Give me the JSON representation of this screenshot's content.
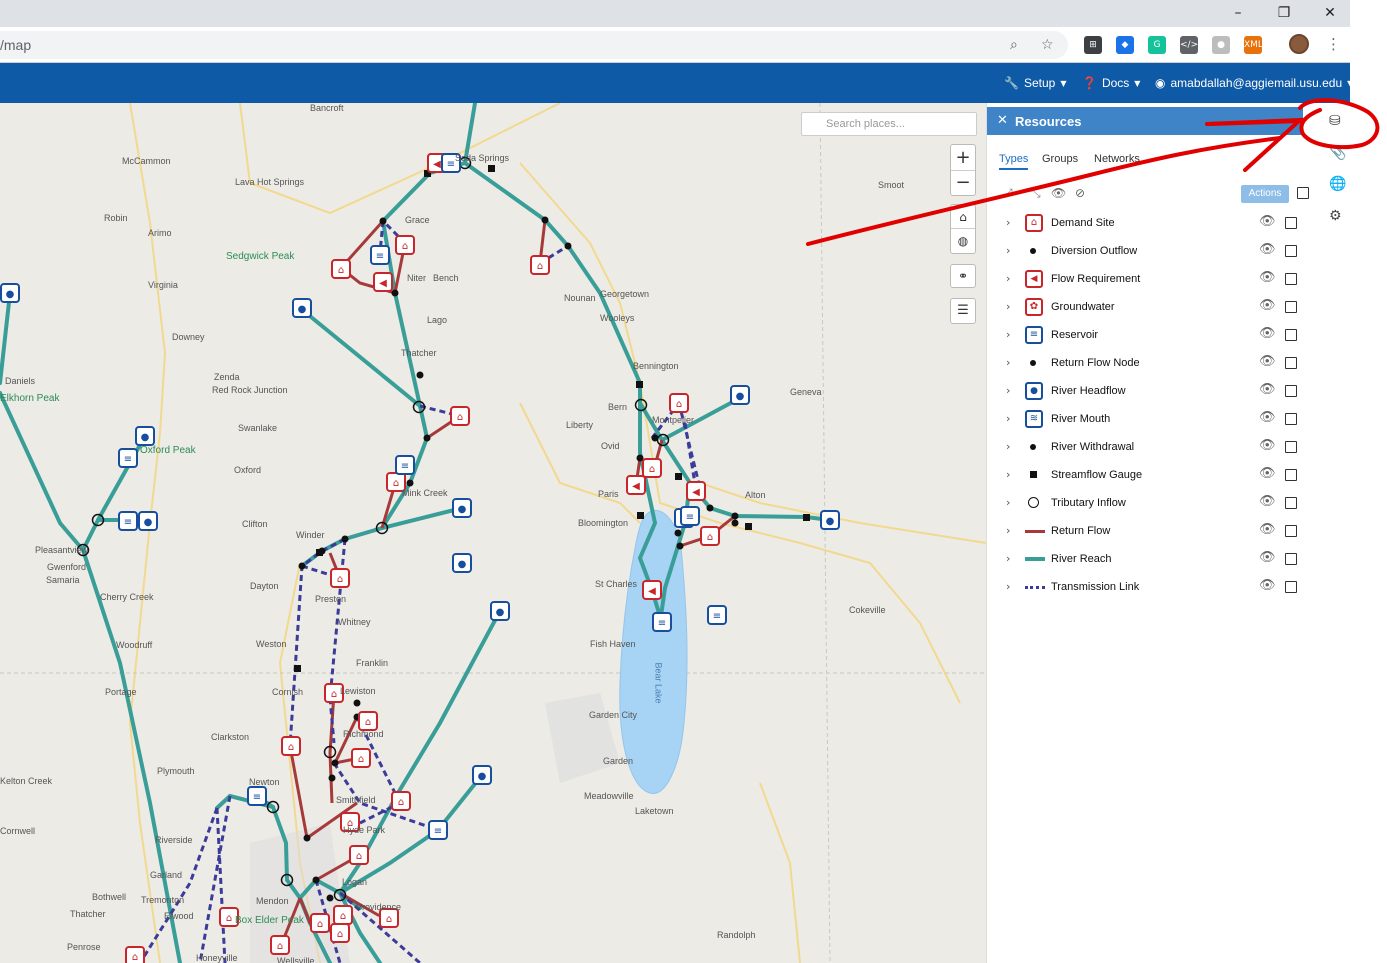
{
  "browser": {
    "url": "/map",
    "window_controls": [
      "–",
      "❐",
      "✕"
    ],
    "extensions": [
      {
        "name": "grid-extension-icon",
        "color": "#3c4043",
        "glyph": "⊞"
      },
      {
        "name": "graduation-cap-icon",
        "color": "#1a73e8",
        "glyph": "◆"
      },
      {
        "name": "grammarly-icon",
        "color": "#15c39a",
        "glyph": "G"
      },
      {
        "name": "code-icon",
        "color": "#5f6368",
        "glyph": "</>"
      },
      {
        "name": "circle-extension-icon",
        "color": "#bdbdbd",
        "glyph": "●"
      },
      {
        "name": "xml-extension-icon",
        "color": "#e8710a",
        "glyph": "XML"
      }
    ]
  },
  "navbar": {
    "setup_label": "Setup",
    "docs_label": "Docs",
    "user_label": "amabdallah@aggiemail.usu.edu"
  },
  "map": {
    "search_placeholder": "Search places...",
    "lake_label": "Bear Lake",
    "places": [
      "Bancroft",
      "Soda Springs",
      "McCammon",
      "Lava Hot Springs",
      "Robin",
      "Arimo",
      "Grace",
      "Sedgwick Peak",
      "Niter",
      "Bench",
      "Smoot",
      "Virginia",
      "Lago",
      "Nounan",
      "Georgetown",
      "Wooleys",
      "Downey",
      "Thatcher",
      "Bennington",
      "Geneva",
      "Zenda",
      "Red Rock Junction",
      "Daniels",
      "Elkhorn Peak",
      "Swanlake",
      "Liberty",
      "Bern",
      "Montpelier",
      "Oxford Peak",
      "Ovid",
      "Oxford",
      "Mink Creek",
      "Paris",
      "Alton",
      "Clifton",
      "Winder",
      "Bloomington",
      "Pleasantview",
      "Gwenford",
      "Samaria",
      "Dayton",
      "Cherry Creek",
      "St Charles",
      "Preston",
      "Cokeville",
      "Whitney",
      "Woodruff",
      "Weston",
      "Fish Haven",
      "Franklin",
      "Portage",
      "Cornish",
      "Lewiston",
      "Garden City",
      "Clarkston",
      "Richmond",
      "Plymouth",
      "Garden",
      "Newton",
      "Meadowville",
      "Smithfield",
      "Laketown",
      "Riverside",
      "Hyde Park",
      "Logan",
      "Garland",
      "Mendon",
      "Bothwell",
      "Tremonton",
      "Thatcher",
      "Elwood",
      "Box Elder Peak",
      "Providence",
      "Randolph",
      "Penrose",
      "Honeyville",
      "Wellsville",
      "Kelton Creek",
      "Cornwell"
    ]
  },
  "panel": {
    "title": "Resources",
    "tabs": [
      "Types",
      "Groups",
      "Networks"
    ],
    "actions_label": "Actions",
    "types": [
      {
        "label": "Demand Site",
        "symbol": "demand-site-icon"
      },
      {
        "label": "Diversion Outflow",
        "symbol": "dot-icon"
      },
      {
        "label": "Flow Requirement",
        "symbol": "flow-requirement-icon"
      },
      {
        "label": "Groundwater",
        "symbol": "groundwater-icon"
      },
      {
        "label": "Reservoir",
        "symbol": "reservoir-icon"
      },
      {
        "label": "Return Flow Node",
        "symbol": "dot-icon"
      },
      {
        "label": "River Headflow",
        "symbol": "river-headflow-icon"
      },
      {
        "label": "River Mouth",
        "symbol": "river-mouth-icon"
      },
      {
        "label": "River Withdrawal",
        "symbol": "dot-icon"
      },
      {
        "label": "Streamflow Gauge",
        "symbol": "square-icon"
      },
      {
        "label": "Tributary Inflow",
        "symbol": "circle-icon"
      },
      {
        "label": "Return Flow",
        "symbol": "return-flow-line-icon"
      },
      {
        "label": "River Reach",
        "symbol": "river-reach-line-icon"
      },
      {
        "label": "Transmission Link",
        "symbol": "transmission-link-line-icon"
      }
    ]
  },
  "colors": {
    "navbar": "#0f5aa6",
    "panel_header": "#3e84c6",
    "river_reach": "#3a9e98",
    "return_flow": "#a63a3a",
    "transmission_link": "#3b3b9a",
    "demand_red": "#c8262b",
    "headflow_blue": "#174f9e",
    "annotation_red": "#e10000"
  }
}
